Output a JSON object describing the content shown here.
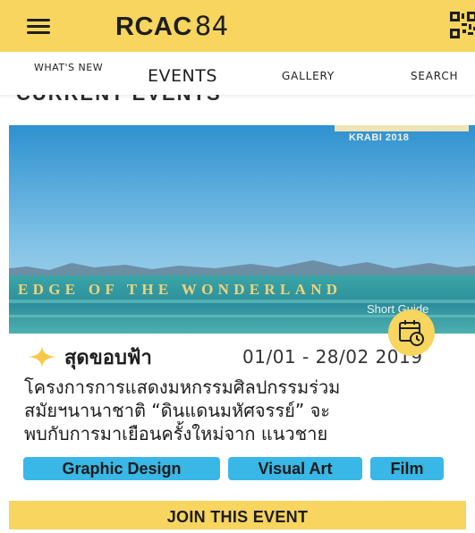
{
  "app": {
    "brand_bold": "RCAC",
    "brand_number": "84",
    "accent_color": "#f7d55e",
    "menu_icon": "hamburger-menu-icon",
    "qr_icon": "qr-code-icon"
  },
  "tabs": {
    "whats_new": "WHAT'S NEW",
    "events": "EVENTS",
    "gallery": "GALLERY",
    "search": "SEARCH"
  },
  "section": {
    "heading": "CURRENT EVENTS"
  },
  "hero": {
    "subtitle": "KRABI 2018",
    "title": "EDGE OF THE WONDERLAND",
    "guide": "Short Guide",
    "calendar_icon": "calendar-clock-icon"
  },
  "event": {
    "icon": "sparkle-star-icon",
    "name": "สุดขอบฟ้า",
    "date": "01/01 - 28/02 2019",
    "description_lines": [
      "โครงการการแสดงมหกรรมศิลปกรรมร่วม",
      "สมัยฯนานาชาติ  “ดินแดนมหัศจรรย์” จะ",
      "พบกับการมาเยือนครั้งใหม่จาก แนวชาย"
    ],
    "tags": [
      "Graphic Design",
      "Visual Art",
      "Film"
    ],
    "tag_color": "#39b7e6",
    "join_label": "JOIN THIS EVENT"
  }
}
